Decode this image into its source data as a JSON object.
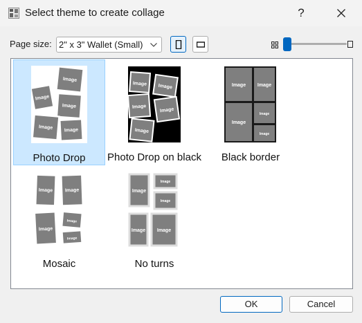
{
  "window": {
    "title": "Select theme to create collage",
    "help_label": "?"
  },
  "toolbar": {
    "page_size_label": "Page size:",
    "page_size_value": "2\" x 3\" Wallet (Small)",
    "orientation_selected": "portrait",
    "thumbnail_size_fraction": 0.0
  },
  "themes": [
    {
      "label": "Photo Drop",
      "selected": true
    },
    {
      "label": "Photo Drop on black",
      "selected": false
    },
    {
      "label": "Black border",
      "selected": false
    },
    {
      "label": "Mosaic",
      "selected": false
    },
    {
      "label": "No turns",
      "selected": false
    }
  ],
  "placeholder_text": "Image",
  "buttons": {
    "ok_label": "OK",
    "cancel_label": "Cancel"
  },
  "colors": {
    "accent": "#0067c0",
    "selection_bg": "#cce8ff",
    "placeholder_gray": "#7f7f7f"
  }
}
